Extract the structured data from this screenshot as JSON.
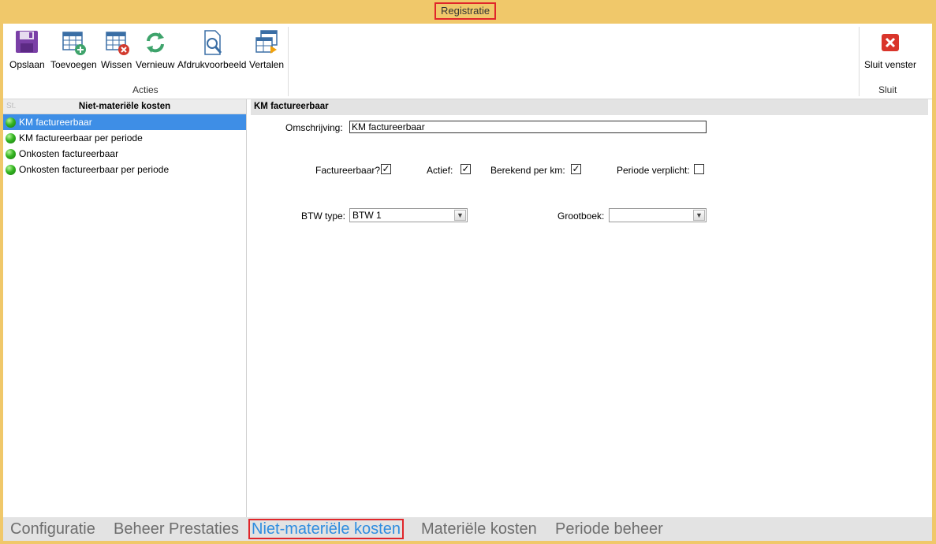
{
  "window": {
    "title": "Registratie"
  },
  "ribbon": {
    "groups": [
      {
        "label": "Acties"
      },
      {
        "label": "Sluit"
      }
    ],
    "buttons": {
      "save": "Opslaan",
      "add": "Toevoegen",
      "delete": "Wissen",
      "refresh": "Vernieuw",
      "preview": "Afdrukvoorbeeld",
      "translate": "Vertalen",
      "close": "Sluit venster"
    },
    "icons": {
      "save": "floppy-disk-icon",
      "add": "table-add-icon",
      "delete": "table-delete-icon",
      "refresh": "refresh-icon",
      "preview": "print-preview-icon",
      "translate": "translate-table-icon",
      "close": "close-red-icon"
    }
  },
  "left_panel": {
    "stub": "St.",
    "header": "Niet-materiële kosten",
    "items": [
      {
        "label": "KM factureerbaar",
        "selected": true
      },
      {
        "label": "KM factureerbaar per periode",
        "selected": false
      },
      {
        "label": "Onkosten factureerbaar",
        "selected": false
      },
      {
        "label": "Onkosten factureerbaar per periode",
        "selected": false
      }
    ]
  },
  "detail": {
    "header": "KM factureerbaar",
    "description_label": "Omschrijving:",
    "description_value": "KM factureerbaar",
    "checkboxes": [
      {
        "label": "Factureerbaar?",
        "checked": true
      },
      {
        "label": "Actief:",
        "checked": true
      },
      {
        "label": "Berekend per km:",
        "checked": true
      },
      {
        "label": "Periode verplicht:",
        "checked": false
      }
    ],
    "vat_label": "BTW type:",
    "vat_value": "BTW 1",
    "ledger_label": "Grootboek:",
    "ledger_value": ""
  },
  "tabs": [
    {
      "label": "Configuratie",
      "active": false
    },
    {
      "label": "Beheer Prestaties",
      "active": false
    },
    {
      "label": "Niet-materiële kosten",
      "active": true
    },
    {
      "label": "Materiële kosten",
      "active": false
    },
    {
      "label": "Periode beheer",
      "active": false
    }
  ],
  "colors": {
    "accent": "#3e8ee6",
    "titlebar": "#f0c86a",
    "highlight": "#e0262a",
    "active_tab": "#2f8de0"
  }
}
